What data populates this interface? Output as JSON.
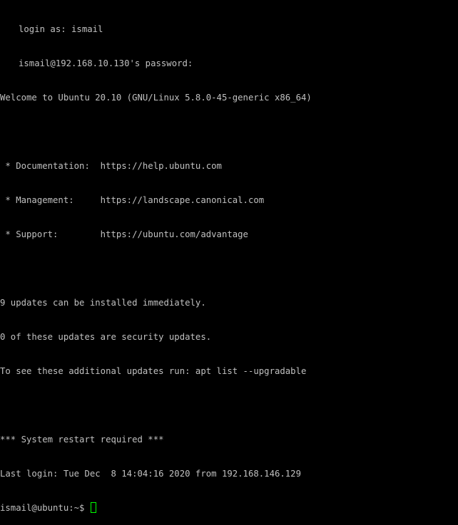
{
  "colors": {
    "background": "#000000",
    "foreground": "#c0c0c0",
    "cursor": "#00ff00"
  },
  "terminal": {
    "login_line": "login as: ismail",
    "password_line": "ismail@192.168.10.130's password:",
    "welcome": "Welcome to Ubuntu 20.10 (GNU/Linux 5.8.0-45-generic x86_64)",
    "documentation": " * Documentation:  https://help.ubuntu.com",
    "management": " * Management:     https://landscape.canonical.com",
    "support": " * Support:        https://ubuntu.com/advantage",
    "updates_available": "9 updates can be installed immediately.",
    "security_updates": "0 of these updates are security updates.",
    "see_updates": "To see these additional updates run: apt list --upgradable",
    "restart_required": "*** System restart required ***",
    "last_login": "Last login: Tue Dec  8 14:04:16 2020 from 192.168.146.129",
    "prompt": "ismail@ubuntu:~$ ",
    "key_icon": "key-icon"
  }
}
